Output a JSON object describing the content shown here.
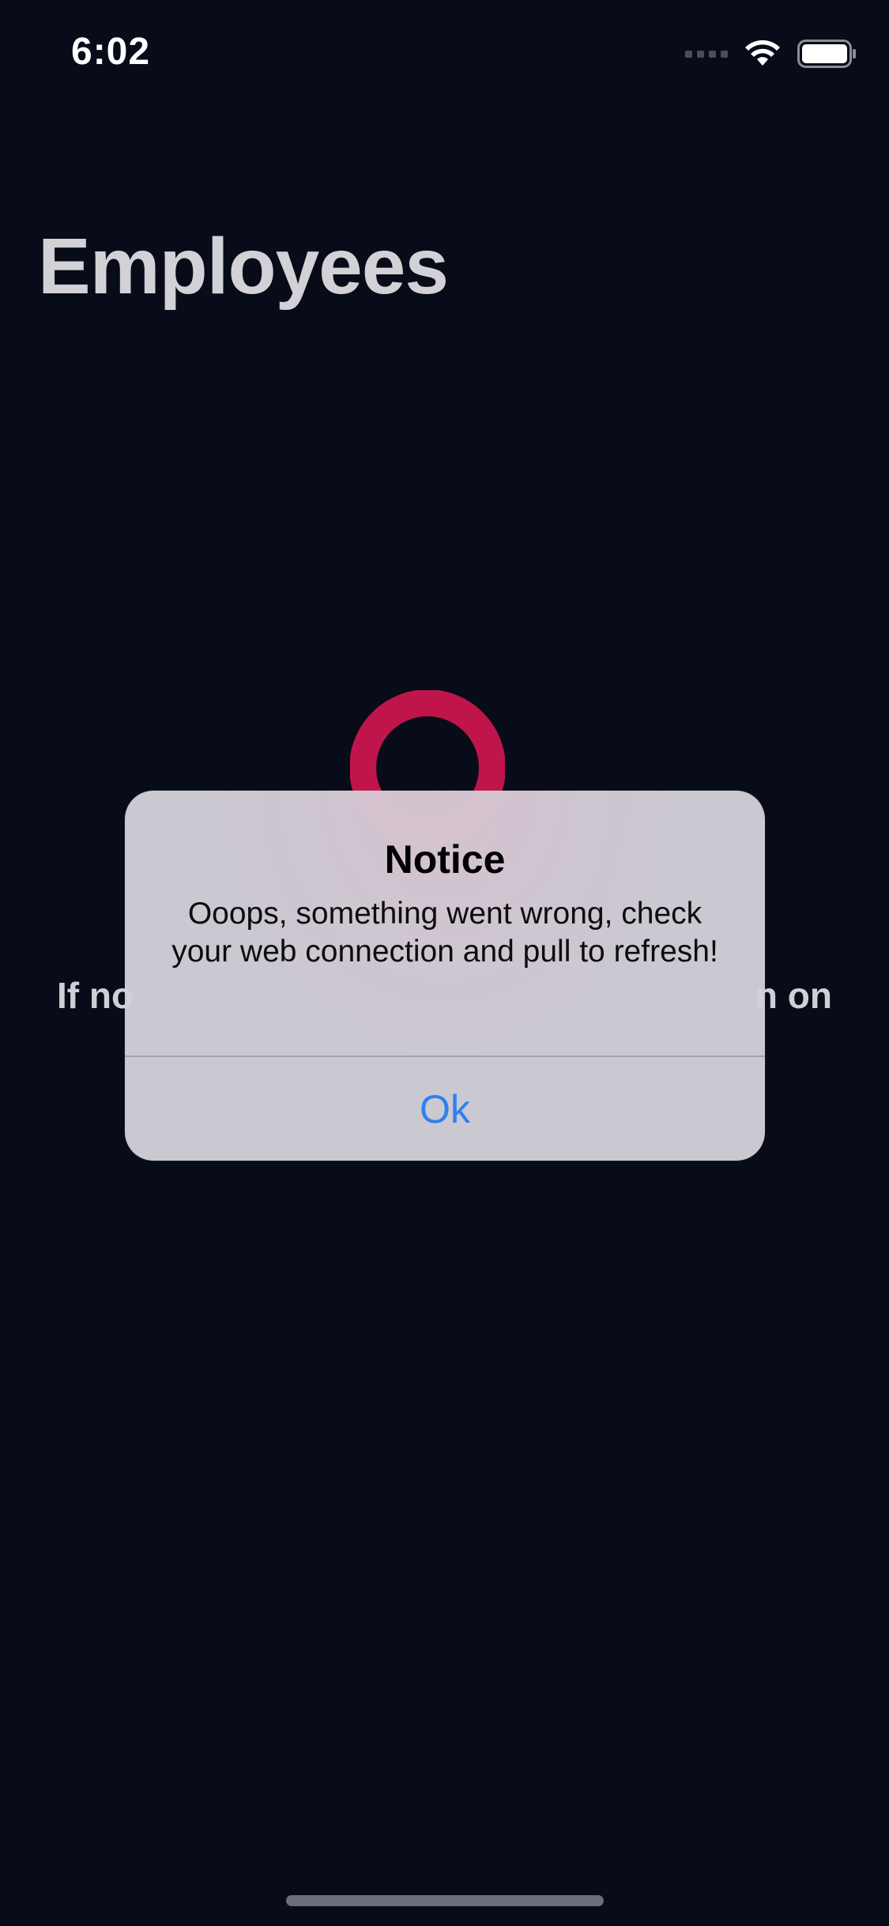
{
  "status_bar": {
    "time": "6:02",
    "icons": [
      "cellular-signal-icon",
      "wifi-icon",
      "battery-icon"
    ]
  },
  "page": {
    "title": "Employees",
    "background_text_visible_left": "If no",
    "background_text_visible_right": "n on"
  },
  "loading": {
    "icon": "loading-ring-icon",
    "color": "#c0154a"
  },
  "alert": {
    "title": "Notice",
    "message": "Ooops, something went wrong, check your web connection and pull to refresh!",
    "button_label": "Ok",
    "button_color": "#2f7ff0"
  },
  "colors": {
    "background": "#080b18",
    "title_text": "#d2d2d6",
    "accent": "#c0154a"
  }
}
